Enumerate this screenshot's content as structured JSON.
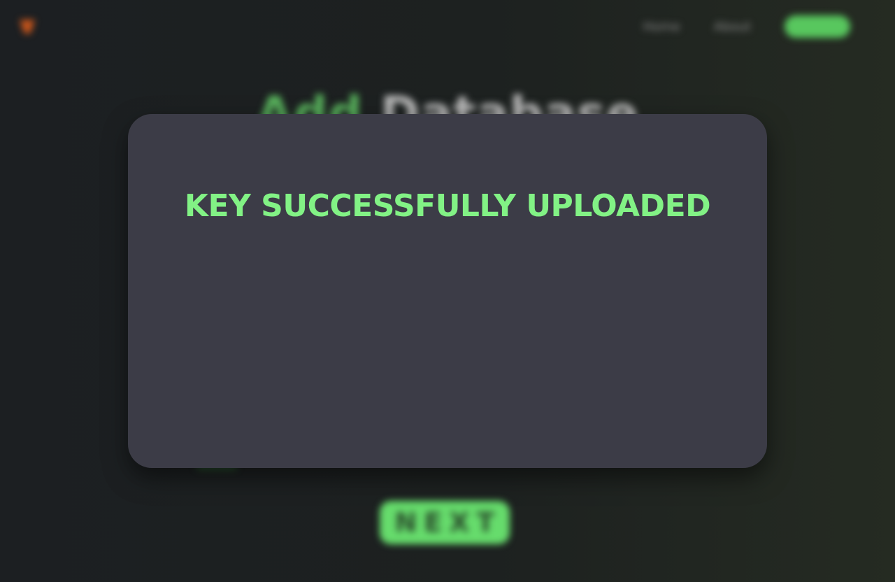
{
  "colors": {
    "accent_green": "#82f285",
    "modal_background": "#3c3c47",
    "page_background": "#1c1f22",
    "logo_orange": "#c8551b"
  },
  "modal": {
    "message": "KEY SUCCESSFULLY UPLOADED"
  },
  "background_page": {
    "header": {
      "logo_icon": "shield-logo-icon",
      "logo_text": "",
      "nav": [
        {
          "label": "Home"
        },
        {
          "label": "About"
        }
      ],
      "cta_label": ""
    },
    "title_accent": "Add",
    "title_rest": "Database",
    "next_label": "NEXT"
  }
}
